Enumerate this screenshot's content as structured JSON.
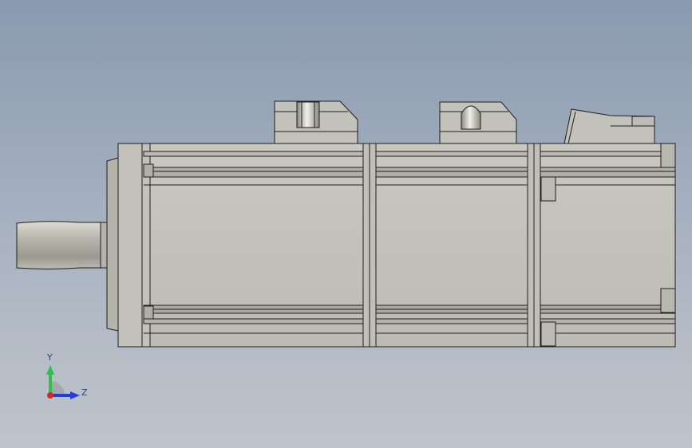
{
  "viewport": {
    "background_top": "#8a9ab0",
    "background_bottom": "#bfc4ca"
  },
  "model": {
    "part_color": "#c4c4bc",
    "edge_color": "#1e1e1e",
    "shaft_color": "#b8b8ae"
  },
  "triad": {
    "y_label": "Y",
    "z_label": "Z",
    "y_color": "#2ec24a",
    "z_color": "#2a3cd8",
    "x_color": "#d8282a"
  }
}
